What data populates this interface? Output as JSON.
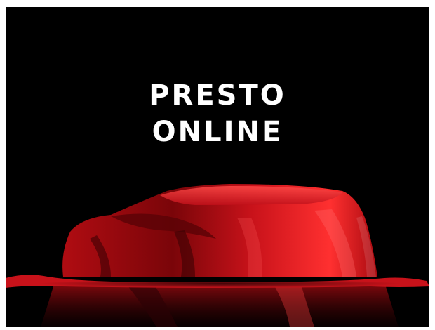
{
  "headline": {
    "line1": "PRESTO",
    "line2": "ONLINE"
  },
  "colors": {
    "background": "#000000",
    "cover_red": "#d8141c",
    "cover_highlight": "#ff3a3a",
    "text": "#ffffff"
  },
  "image": {
    "subject": "car-covered-with-red-cloth-icon"
  }
}
